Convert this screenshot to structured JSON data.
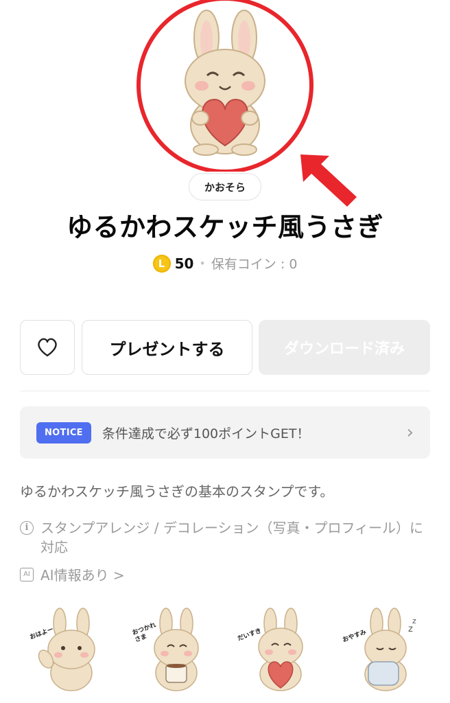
{
  "hero": {
    "image_icon": "bunny-holding-heart-icon",
    "highlight_color": "#e8262c"
  },
  "author": {
    "name": "かおそら"
  },
  "sticker_set": {
    "title": "ゆるかわスケッチ風うさぎ",
    "price": "50",
    "coin_label": "L",
    "owned_coins": "保有コイン : 0"
  },
  "actions": {
    "favorite_icon": "heart-outline-icon",
    "present_label": "プレゼントする",
    "download_label": "ダウンロード済み"
  },
  "notice": {
    "badge": "NOTICE",
    "text": "条件達成で必ず100ポイントGET！",
    "chevron": "›"
  },
  "description": "ゆるかわスケッチ風うさぎの基本のスタンプです。",
  "feature": {
    "icon": "i",
    "text": "スタンプアレンジ / デコレーション（写真・プロフィール）に対応"
  },
  "ai_info": {
    "icon": "AI",
    "text": "AI情報あり >"
  },
  "stickers": [
    {
      "icon": "bunny-waving-icon",
      "caption": "おはよー"
    },
    {
      "icon": "bunny-coffee-icon",
      "caption": "おつかれさま"
    },
    {
      "icon": "bunny-heart-icon",
      "caption": "だいすき"
    },
    {
      "icon": "bunny-sleeping-icon",
      "caption": "おやすみ"
    }
  ]
}
